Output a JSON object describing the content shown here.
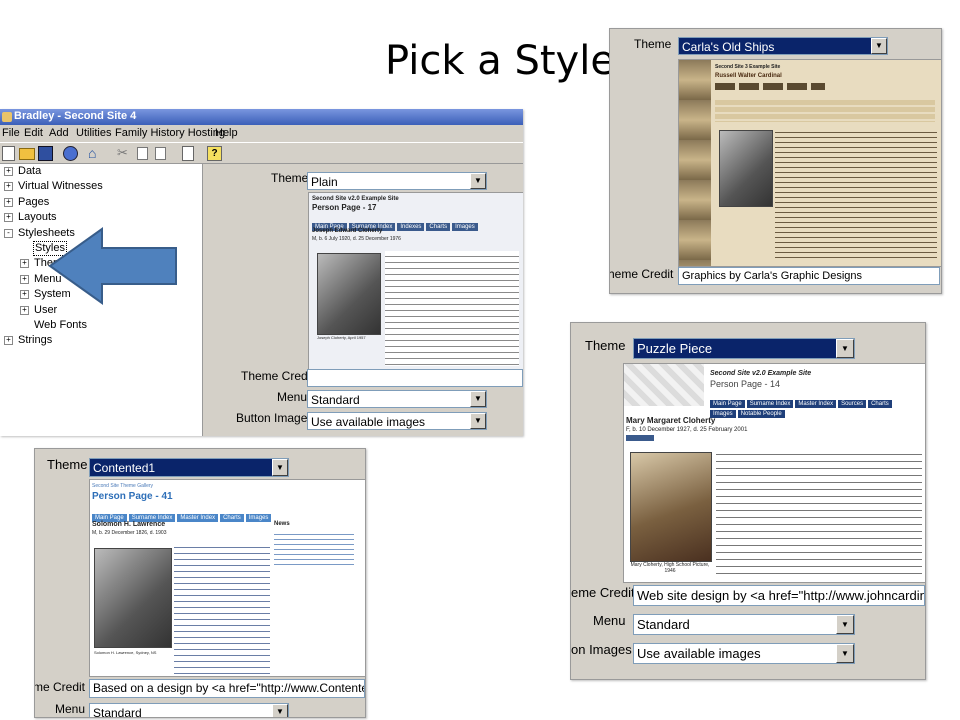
{
  "slide_title": "Pick a Style",
  "main_window": {
    "title": "Bradley - Second Site 4",
    "menu": [
      "File",
      "Edit",
      "Add",
      "Utilities",
      "Family History Hosting",
      "Help"
    ],
    "tree": [
      {
        "label": "Data",
        "expander": "+"
      },
      {
        "label": "Virtual Witnesses",
        "expander": "+"
      },
      {
        "label": "Pages",
        "expander": "+"
      },
      {
        "label": "Layouts",
        "expander": "+"
      },
      {
        "label": "Stylesheets",
        "expander": "-"
      },
      {
        "label": "Styles",
        "child": true,
        "selected": true
      },
      {
        "label": "Theme",
        "child": true,
        "expander": "+"
      },
      {
        "label": "Menu",
        "child": true,
        "expander": "+"
      },
      {
        "label": "System",
        "child": true,
        "expander": "+"
      },
      {
        "label": "User",
        "child": true,
        "expander": "+"
      },
      {
        "label": "Web Fonts",
        "child": true
      },
      {
        "label": "Strings",
        "expander": "+"
      }
    ],
    "theme_label": "Theme",
    "theme_value": "Plain",
    "theme_credit_label": "Theme Credit",
    "theme_credit_value": "",
    "menu_label": "Menu",
    "menu_value": "Standard",
    "button_images_label": "Button Images",
    "button_images_value": "Use available images",
    "preview": {
      "site_title": "Second Site v2.0 Example Site",
      "page_title": "Person Page - 17",
      "nav": [
        "Main Page",
        "Surname Index",
        "Indexes",
        "Charts",
        "Images"
      ],
      "person_name": "Joseph Edward Cloherty",
      "person_dates": "M, b. 6 July 1920, d. 25 December 1976",
      "caption": "Joseph Cloherty, April 1957"
    }
  },
  "carla": {
    "theme_label": "Theme",
    "theme_value": "Carla's Old Ships",
    "credit_label": "heme Credit",
    "credit_value": "Graphics by Carla's Graphic Designs",
    "preview": {
      "site_title": "Second Site 3 Example Site",
      "person": "Russell Walter Cardinal"
    }
  },
  "puzzle": {
    "theme_label": "Theme",
    "theme_value": "Puzzle Piece",
    "preview": {
      "site_title": "Second Site v2.0 Example Site",
      "page_title": "Person Page - 14",
      "nav": [
        "Main Page",
        "Surname Index",
        "Master Index",
        "Sources",
        "Charts"
      ],
      "nav2": [
        "Images",
        "Notable People"
      ],
      "person_name": "Mary Margaret Cloherty",
      "person_dates": "F, b. 10 December 1927, d. 25 February 2001",
      "caption": "Mary Cloherty, High School Picture, 1946"
    },
    "credit_label": "eme Credit",
    "credit_value": "Web site design by <a href=\"http://www.johncardin",
    "menu_label": "Menu",
    "menu_value": "Standard",
    "button_images_label": "on Images",
    "button_images_value": "Use available images"
  },
  "contented": {
    "theme_label": "Theme",
    "theme_value": "Contented1",
    "preview": {
      "site_title": "Second Site Theme Gallery",
      "page_title": "Person Page - 41",
      "nav": [
        "Main Page",
        "Surname Index",
        "Master Index",
        "Charts",
        "Images"
      ],
      "person_name": "Solomon H. Lawrence",
      "person_dates": "M, b. 29 December 1826, d. 1903",
      "news_heading": "News",
      "caption": "Solomon H. Lawrence, Sydney, NS"
    },
    "credit_label": "me Credit",
    "credit_value": "Based on a design by <a href=\"http://www.Contented",
    "menu_label": "Menu",
    "menu_value": "Standard"
  },
  "colors": {
    "window_bg": "#d4d0c8",
    "selection": "#0a246a",
    "arrow_fill": "#4f81bd",
    "arrow_stroke": "#385d8a"
  }
}
